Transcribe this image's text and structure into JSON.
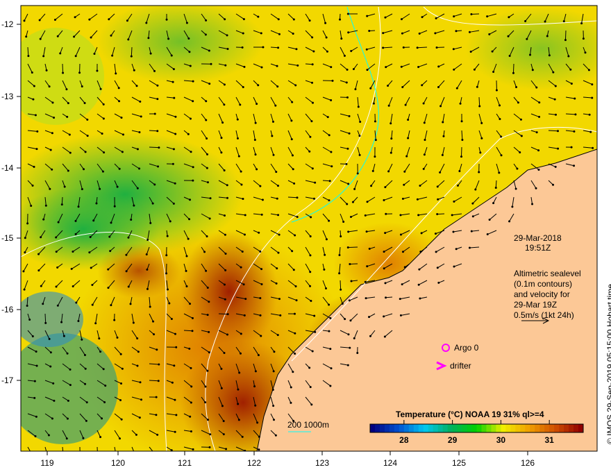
{
  "axes": {
    "x_ticks": [
      "119",
      "120",
      "121",
      "122",
      "123",
      "124",
      "125",
      "126"
    ],
    "y_ticks": [
      "-12",
      "-13",
      "-14",
      "-15",
      "-16",
      "-17"
    ]
  },
  "annotation": {
    "date": "29-Mar-2018",
    "time": "19:51Z",
    "altimetry_lines": [
      "Altimetric sealevel",
      "(0.1m contours)",
      "and velocity for",
      "29-Mar 19Z",
      "0.5m/s (1kt 24h)"
    ]
  },
  "legend": {
    "argo": "Argo 0",
    "drifter": "drifter",
    "depth": "200  1000m"
  },
  "colorbar": {
    "title": "Temperature (°C) NOAA 19 31% ql>=4",
    "ticks": [
      "28",
      "29",
      "30",
      "31"
    ],
    "range": [
      27.3,
      31.7
    ],
    "colors": [
      "#00007f",
      "#0050d0",
      "#00c8f0",
      "#00b060",
      "#00d000",
      "#f0f000",
      "#f0a000",
      "#d05000",
      "#900000"
    ]
  },
  "credit": "© IMOS 29-Sep-2019 05:15:00 Hobart time",
  "colors": {
    "land": "#fcc896",
    "contour": "#ffffff",
    "depth_contour": "#00ffff",
    "marker": "#ff00ff"
  }
}
